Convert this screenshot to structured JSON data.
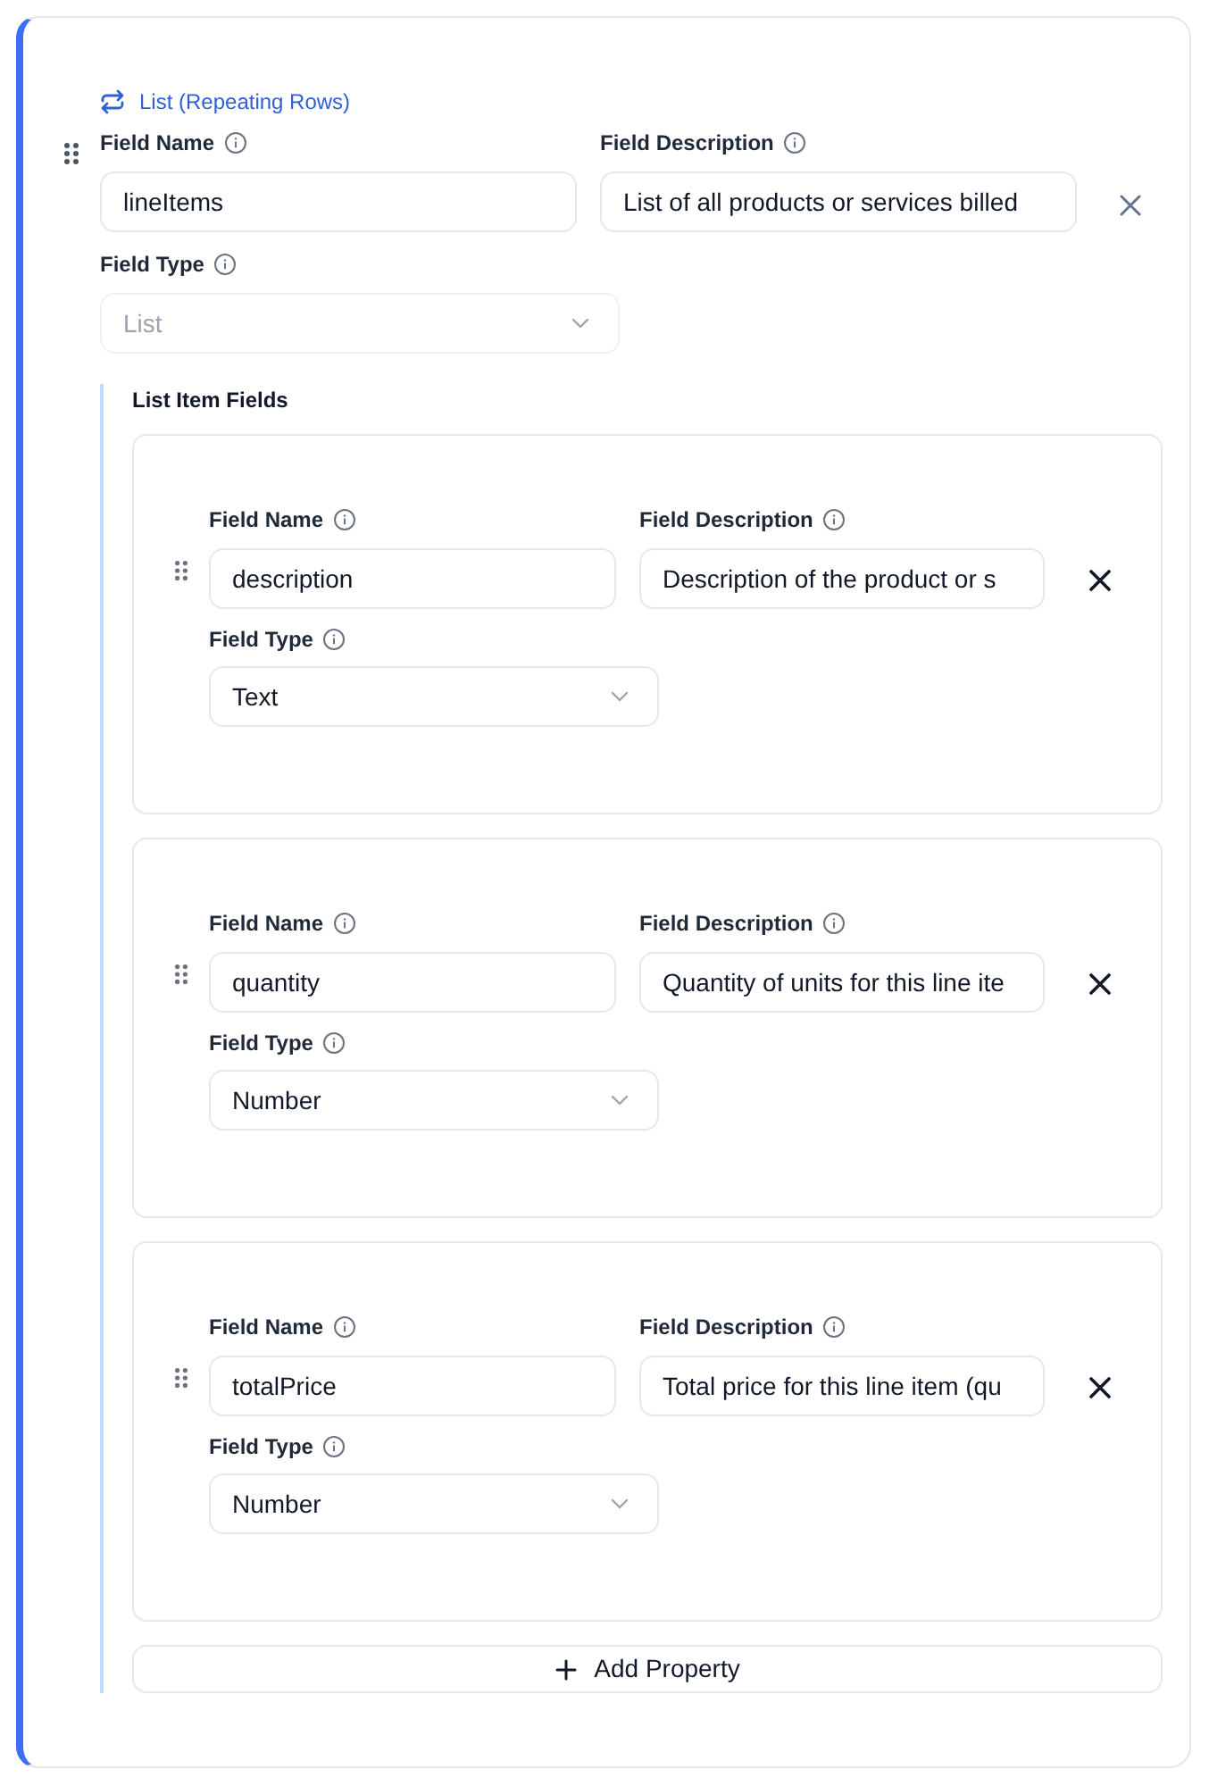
{
  "field": {
    "badge": "List (Repeating Rows)",
    "name": {
      "label": "Field Name",
      "value": "lineItems"
    },
    "description": {
      "label": "Field Description",
      "value": "List of all products or services billed"
    },
    "type": {
      "label": "Field Type",
      "value": "List",
      "disabled": true
    },
    "list_item_fields": {
      "title": "List Item Fields",
      "items": [
        {
          "name": {
            "label": "Field Name",
            "value": "description"
          },
          "description": {
            "label": "Field Description",
            "value": "Description of the product or s"
          },
          "type": {
            "label": "Field Type",
            "value": "Text",
            "disabled": false
          }
        },
        {
          "name": {
            "label": "Field Name",
            "value": "quantity"
          },
          "description": {
            "label": "Field Description",
            "value": "Quantity of units for this line ite"
          },
          "type": {
            "label": "Field Type",
            "value": "Number",
            "disabled": false
          }
        },
        {
          "name": {
            "label": "Field Name",
            "value": "totalPrice"
          },
          "description": {
            "label": "Field Description",
            "value": "Total price for this line item (qu"
          },
          "type": {
            "label": "Field Type",
            "value": "Number",
            "disabled": false
          }
        }
      ],
      "add_button": "Add Property"
    }
  }
}
